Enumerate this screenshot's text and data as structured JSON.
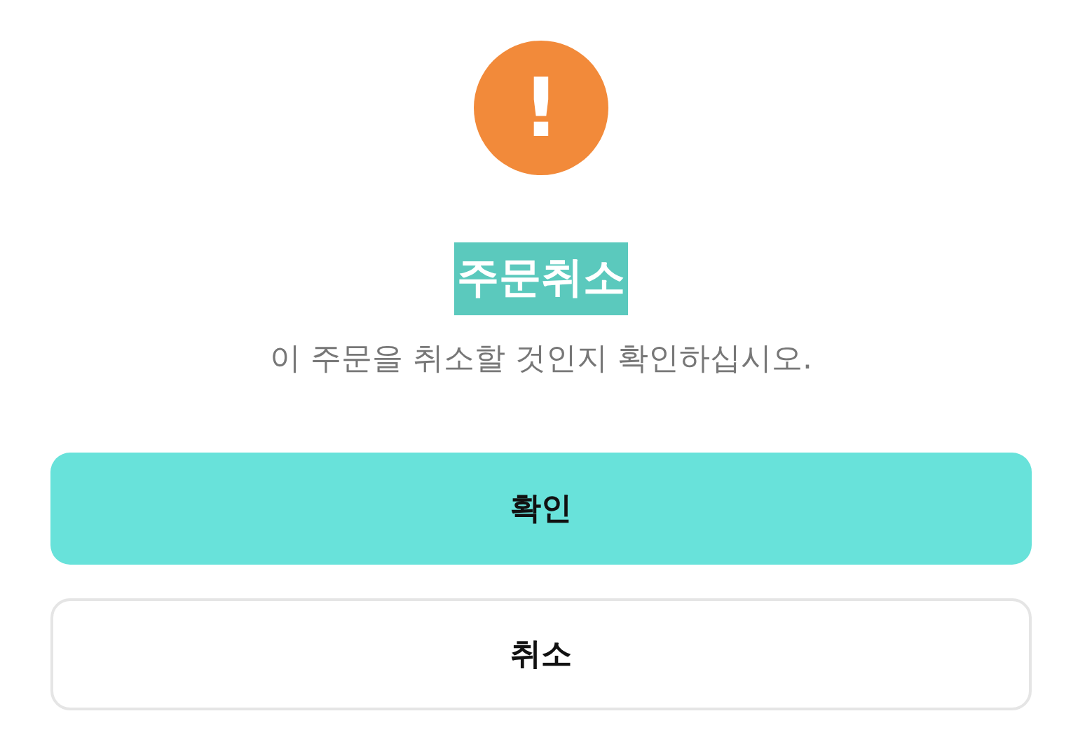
{
  "dialog": {
    "icon": "!",
    "title": {
      "text": "주문취소",
      "highlighted": true
    },
    "message": "이 주문을 취소할 것인지 확인하십시오.",
    "buttons": [
      {
        "label": "확인",
        "kind": "primary"
      },
      {
        "label": "취소",
        "kind": "secondary"
      }
    ]
  }
}
